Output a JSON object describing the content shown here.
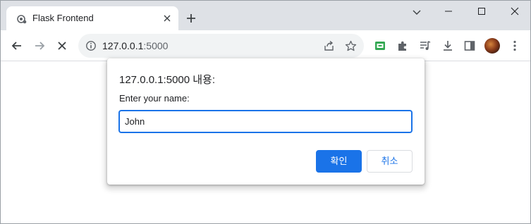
{
  "browser": {
    "tab": {
      "title": "Flask Frontend"
    },
    "address": {
      "host": "127.0.0.1",
      "port": ":5000"
    }
  },
  "dialog": {
    "title": "127.0.0.1:5000 내용:",
    "prompt": "Enter your name:",
    "input_value": "John",
    "ok_label": "확인",
    "cancel_label": "취소"
  },
  "colors": {
    "accent": "#1a73e8",
    "tabstrip": "#dee1e6",
    "omnibox": "#f1f3f4"
  }
}
